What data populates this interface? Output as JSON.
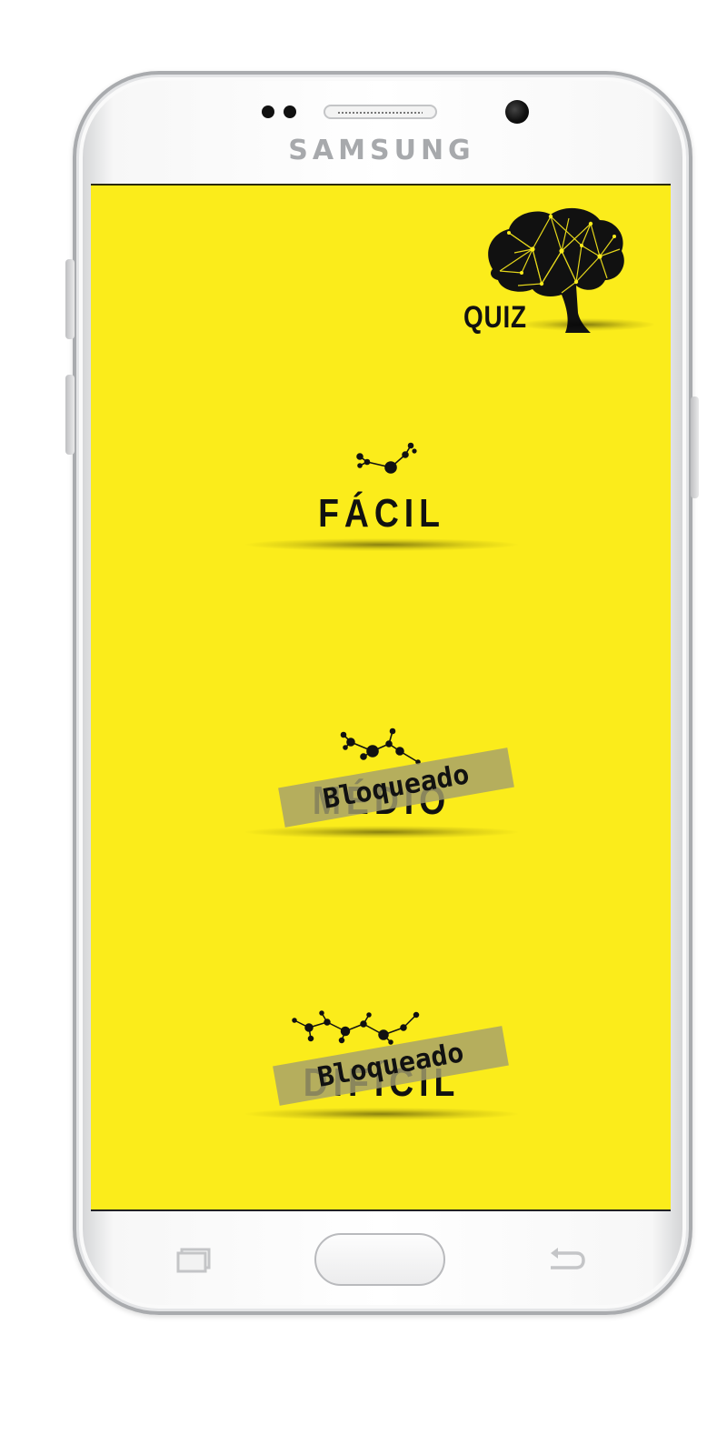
{
  "device": {
    "brand": "SAMSUNG"
  },
  "app": {
    "background_color": "#fbec1b",
    "logo": {
      "icon": "brain-network-icon",
      "label": "QUIZ"
    },
    "levels": [
      {
        "label": "FÁCIL",
        "icon": "molecule-small-icon",
        "locked": false
      },
      {
        "label": "MÉDIO",
        "icon": "molecule-medium-icon",
        "locked": true,
        "lock_label": "Bloqueado"
      },
      {
        "label": "DIFÍCIL",
        "icon": "molecule-large-icon",
        "locked": true,
        "lock_label": "Bloqueado"
      }
    ]
  },
  "navigation": {
    "recent_icon": "recent-apps-icon",
    "home_icon": "home-button",
    "back_icon": "back-arrow-icon"
  }
}
